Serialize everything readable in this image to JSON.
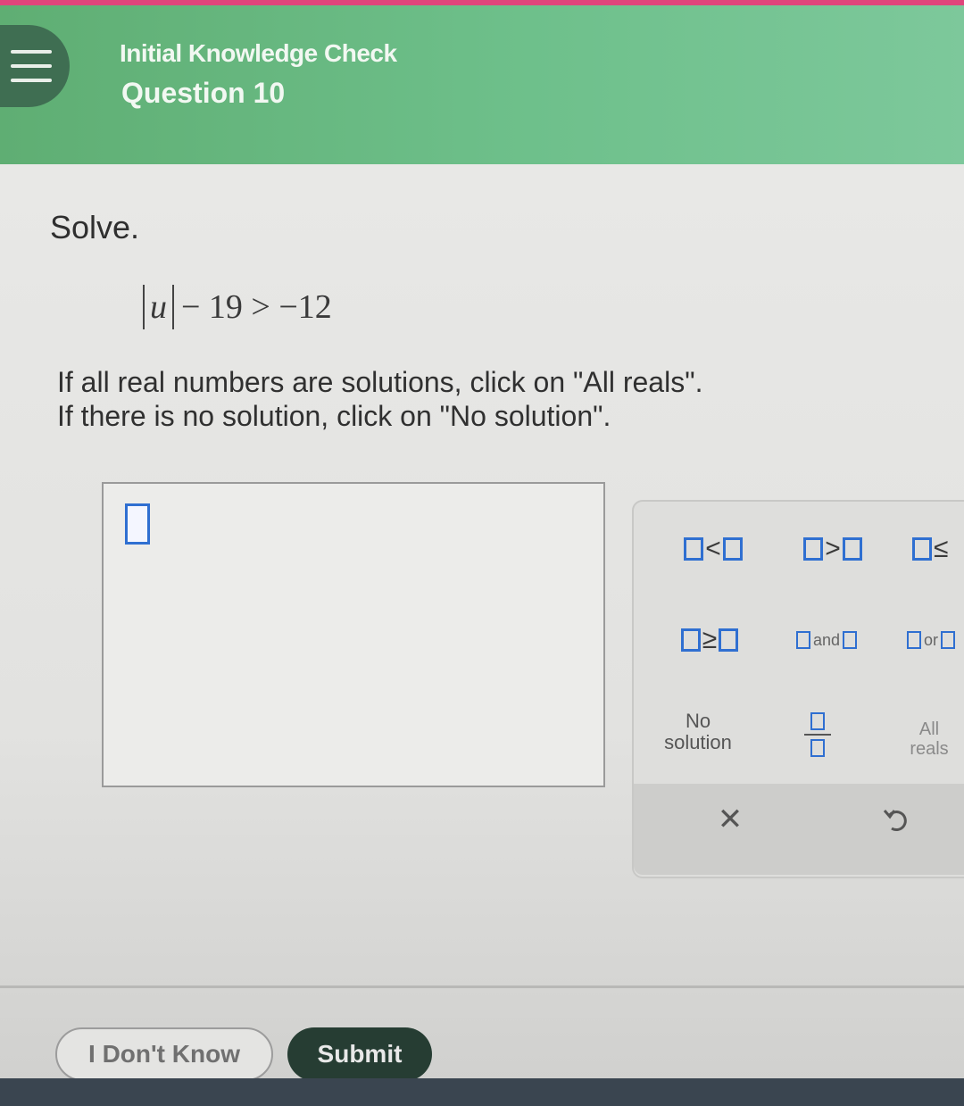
{
  "header": {
    "label": "Initial Knowledge Check",
    "question": "Question 10",
    "menu_icon": "hamburger-menu-icon"
  },
  "problem": {
    "prompt": "Solve.",
    "equation": {
      "variable": "u",
      "rest": "− 19 > −12"
    },
    "instruction_line1": "If all real numbers are solutions, click on \"All reals\".",
    "instruction_line2": "If there is no solution, click on \"No solution\"."
  },
  "keypad": {
    "keys": {
      "less_than": "<",
      "greater_than": ">",
      "less_equal": "≤",
      "greater_equal": "≥",
      "and": "and",
      "or": "or",
      "no_solution_line1": "No",
      "no_solution_line2": "solution",
      "all_reals_line1": "All",
      "all_reals_line2": "reals"
    },
    "clear_symbol": "✕",
    "undo_icon": "undo-icon"
  },
  "footer": {
    "dont_know_label": "I Don't Know",
    "submit_label": "Submit"
  },
  "colors": {
    "header_green": "#6ec08b",
    "accent_blue": "#2f6fd1",
    "submit_dark": "#263d33"
  }
}
